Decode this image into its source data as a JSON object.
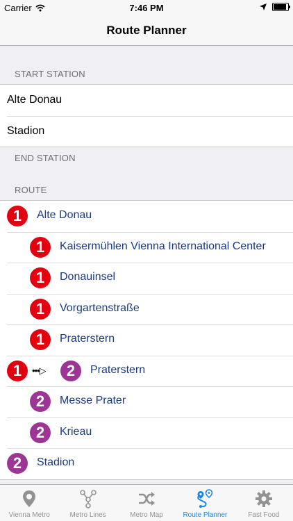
{
  "status": {
    "carrier": "Carrier",
    "time": "7:46 PM"
  },
  "nav": {
    "title": "Route Planner"
  },
  "sections": {
    "start": "START STATION",
    "end": "END STATION",
    "route": "ROUTE"
  },
  "start_stations": [
    "Alte Donau",
    "Stadion"
  ],
  "route": [
    {
      "line": "1",
      "name": "Alte Donau"
    },
    {
      "line": "1",
      "name": "Kaisermühlen Vienna International Center"
    },
    {
      "line": "1",
      "name": "Donauinsel"
    },
    {
      "line": "1",
      "name": "Vorgartenstraße"
    },
    {
      "line": "1",
      "name": "Praterstern"
    },
    {
      "from_line": "1",
      "transfer": "•••▷",
      "line": "2",
      "name": "Praterstern"
    },
    {
      "line": "2",
      "name": "Messe Prater"
    },
    {
      "line": "2",
      "name": "Krieau"
    },
    {
      "line": "2",
      "name": "Stadion"
    }
  ],
  "colors": {
    "u1": "#e3000f",
    "u2": "#9d3595",
    "accent": "#1a86e8"
  },
  "tabs": [
    {
      "label": "Vienna Metro",
      "icon": "map-pin-icon"
    },
    {
      "label": "Metro Lines",
      "icon": "lines-graph-icon"
    },
    {
      "label": "Metro Map",
      "icon": "shuffle-icon"
    },
    {
      "label": "Route Planner",
      "icon": "route-icon",
      "active": true
    },
    {
      "label": "Fast Food",
      "icon": "gear-icon"
    }
  ]
}
